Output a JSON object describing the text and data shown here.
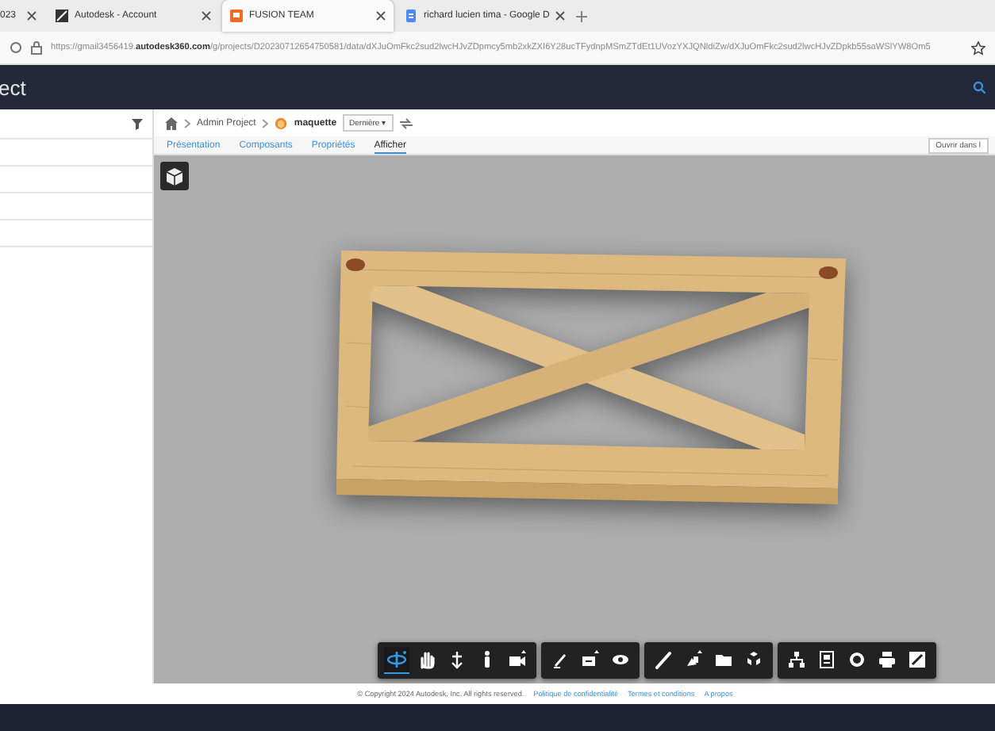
{
  "browser": {
    "tabs": [
      {
        "label": "023",
        "selected": false,
        "kind": "cut"
      },
      {
        "label": "Autodesk - Account",
        "selected": false,
        "kind": "autodesk"
      },
      {
        "label": "FUSION TEAM",
        "selected": true,
        "kind": "fusion"
      },
      {
        "label": "richard lucien tima - Google D",
        "selected": false,
        "kind": "docs"
      }
    ],
    "url": "https://gmail3456419.**autodesk360.com**/g/projects/D20230712654750581/data/dXJuOmFkc2sud2lwcHJvZDpmcy5mb2xkZXI6Y28ucTFydnpMSmZTdEt1UVozYXJQNldiZw/dXJuOmFkc2sud2lwcHJvZDpkb55saWSlYW8Om5"
  },
  "header": {
    "title": "ect"
  },
  "breadcrumb": {
    "project": "Admin Project",
    "item": "maquette",
    "version": "Dernière",
    "version_caret": "▾"
  },
  "tabs": [
    {
      "label": "Présentation",
      "selected": false
    },
    {
      "label": "Composants",
      "selected": false
    },
    {
      "label": "Propriétés",
      "selected": false
    },
    {
      "label": "Afficher",
      "selected": true
    }
  ],
  "open_button": "Ouvrir dans l",
  "toolbar": [
    {
      "tools": [
        {
          "kind": "orbit",
          "selected": true
        },
        {
          "kind": "pan",
          "selected": false
        },
        {
          "kind": "zoom",
          "selected": false
        },
        {
          "kind": "walk",
          "selected": false
        },
        {
          "kind": "camera",
          "selected": false
        }
      ]
    },
    {
      "tools": [
        {
          "kind": "markup",
          "selected": false
        },
        {
          "kind": "section",
          "selected": false
        },
        {
          "kind": "view",
          "selected": false
        }
      ]
    },
    {
      "tools": [
        {
          "kind": "measure",
          "selected": false
        },
        {
          "kind": "explode",
          "selected": false
        },
        {
          "kind": "folder",
          "selected": false
        },
        {
          "kind": "parts",
          "selected": false
        }
      ]
    },
    {
      "tools": [
        {
          "kind": "tree",
          "selected": false
        },
        {
          "kind": "properties",
          "selected": false
        },
        {
          "kind": "settings",
          "selected": false
        },
        {
          "kind": "print",
          "selected": false
        },
        {
          "kind": "fullscreen",
          "selected": false
        }
      ]
    }
  ],
  "footer": {
    "copyright": "© Copyright 2024 Autodesk, Inc. All rights reserved.",
    "links": [
      "Politique de confidentialité",
      "Termes et conditions",
      "A propos"
    ]
  }
}
